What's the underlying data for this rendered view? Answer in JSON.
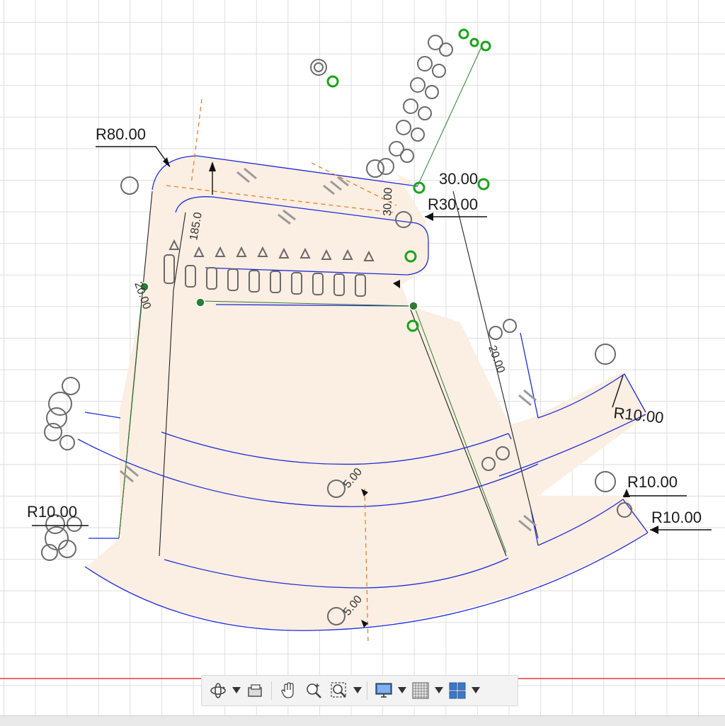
{
  "dimensions": {
    "r80": "R80.00",
    "r30": "R30.00",
    "r10_left": "R10.00",
    "r10_right_mid": "R10.00",
    "r10_right_low_a": "R10.00",
    "r10_right_low_b": "R10.00",
    "d_top": "30.00",
    "d_vertical_left": "185.0",
    "d_vertical_top": "30.00",
    "d_seat_left": "20.00",
    "d_right_mid": "20.00",
    "d_center_mid": "5.00",
    "d_center_low": "5.00"
  },
  "toolbar": {
    "items": [
      {
        "name": "orbit",
        "icon": "orbit-icon"
      },
      {
        "name": "look-at",
        "icon": "look-at-icon"
      },
      {
        "name": "pan",
        "icon": "pan-hand-icon"
      },
      {
        "name": "zoom",
        "icon": "zoom-icon"
      },
      {
        "name": "fit",
        "icon": "fit-window-icon"
      },
      {
        "name": "display-settings",
        "icon": "monitor-icon"
      },
      {
        "name": "grid-snaps",
        "icon": "grid-icon"
      },
      {
        "name": "viewports",
        "icon": "viewports-icon"
      }
    ]
  },
  "colors": {
    "sketch_line": "#1f2bd6",
    "construction": "#e07a1a",
    "constraint_point": "#1aa31a",
    "profile_fill": "#fbeee2",
    "axis_red": "#e23b3b"
  }
}
